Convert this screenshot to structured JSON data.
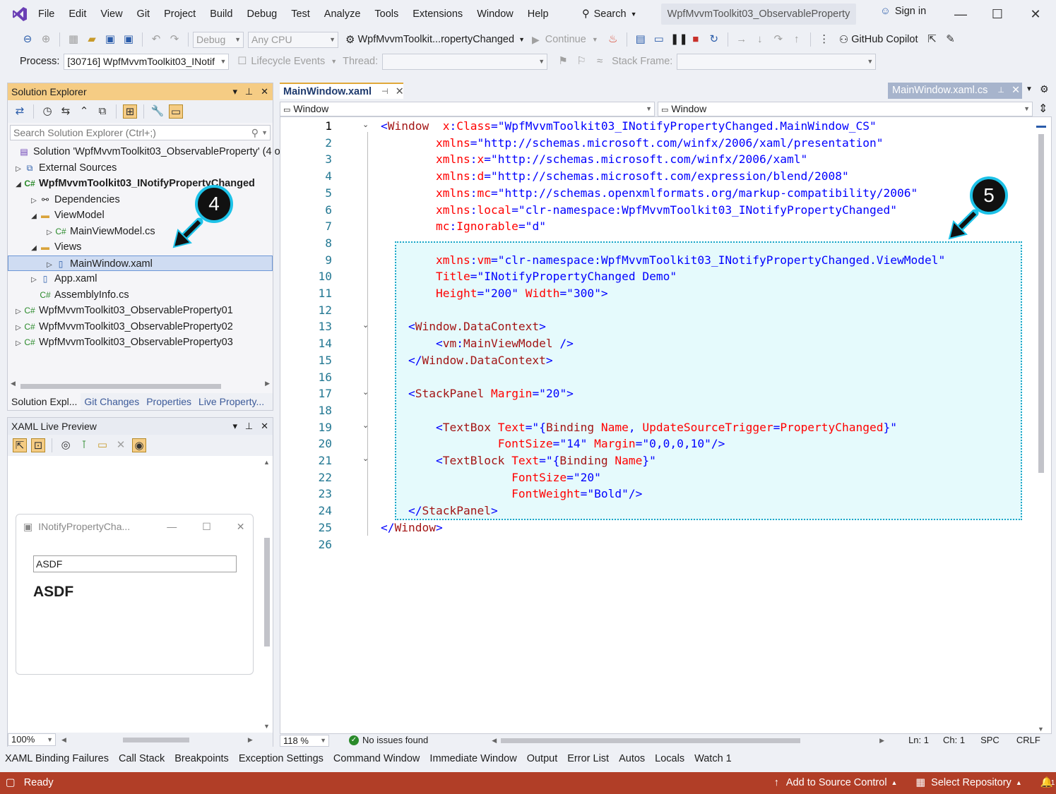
{
  "menu": [
    "File",
    "Edit",
    "View",
    "Git",
    "Project",
    "Build",
    "Debug",
    "Test",
    "Analyze",
    "Tools",
    "Extensions",
    "Window",
    "Help"
  ],
  "search_label": "Search",
  "solution_title": "WpfMvvmToolkit03_ObservableProperty",
  "sign_in": "Sign in",
  "toolbar": {
    "config": "Debug",
    "platform": "Any CPU",
    "startup": "WpfMvvmToolkit...ropertyChanged",
    "continue": "Continue",
    "copilot": "GitHub Copilot",
    "process_label": "Process:",
    "process_value": "[30716] WpfMvvmToolkit03_INotif",
    "lifecycle": "Lifecycle Events",
    "thread_label": "Thread:",
    "stack_label": "Stack Frame:"
  },
  "solution_explorer": {
    "title": "Solution Explorer",
    "search_placeholder": "Search Solution Explorer (Ctrl+;)",
    "items": [
      {
        "label": "Solution 'WpfMvvmToolkit03_ObservableProperty' (4 o",
        "indent": 0
      },
      {
        "label": "External Sources",
        "indent": 1
      },
      {
        "label": "WpfMvvmToolkit03_INotifyPropertyChanged",
        "indent": 1
      },
      {
        "label": "Dependencies",
        "indent": 2
      },
      {
        "label": "ViewModel",
        "indent": 2
      },
      {
        "label": "MainViewModel.cs",
        "indent": 3
      },
      {
        "label": "Views",
        "indent": 2
      },
      {
        "label": "MainWindow.xaml",
        "indent": 3
      },
      {
        "label": "App.xaml",
        "indent": 2
      },
      {
        "label": "AssemblyInfo.cs",
        "indent": 2
      },
      {
        "label": "WpfMvvmToolkit03_ObservableProperty01",
        "indent": 1
      },
      {
        "label": "WpfMvvmToolkit03_ObservableProperty02",
        "indent": 1
      },
      {
        "label": "WpfMvvmToolkit03_ObservableProperty03",
        "indent": 1
      }
    ],
    "tabs": [
      "Solution Expl...",
      "Git Changes",
      "Properties",
      "Live Property..."
    ]
  },
  "xaml_preview": {
    "title": "XAML Live Preview",
    "window_title": "INotifyPropertyCha...",
    "textbox_value": "ASDF",
    "textblock_value": "ASDF",
    "zoom": "100%"
  },
  "editor": {
    "tab": "MainWindow.xaml",
    "tab2": "MainWindow.xaml.cs",
    "nav_left": "Window",
    "nav_right": "Window",
    "zoom": "118 %",
    "issues": "No issues found",
    "ln": "Ln: 1",
    "ch": "Ch: 1",
    "spc": "SPC",
    "crlf": "CRLF",
    "line_numbers": [
      "1",
      "2",
      "3",
      "4",
      "5",
      "6",
      "7",
      "8",
      "9",
      "10",
      "11",
      "12",
      "13",
      "14",
      "15",
      "16",
      "17",
      "18",
      "19",
      "20",
      "21",
      "22",
      "23",
      "24",
      "25",
      "26"
    ]
  },
  "bottom_tabs": [
    "XAML Binding Failures",
    "Call Stack",
    "Breakpoints",
    "Exception Settings",
    "Command Window",
    "Immediate Window",
    "Output",
    "Error List",
    "Autos",
    "Locals",
    "Watch 1"
  ],
  "status": {
    "ready": "Ready",
    "source_control": "Add to Source Control",
    "repo": "Select Repository",
    "notif": "1"
  },
  "callouts": {
    "four": "4",
    "five": "5"
  },
  "colors": {
    "status_bar": "#b13e27",
    "panel_header": "#f5cc84",
    "highlight": "#e5fafc",
    "callout_border": "#1dc2e8"
  }
}
